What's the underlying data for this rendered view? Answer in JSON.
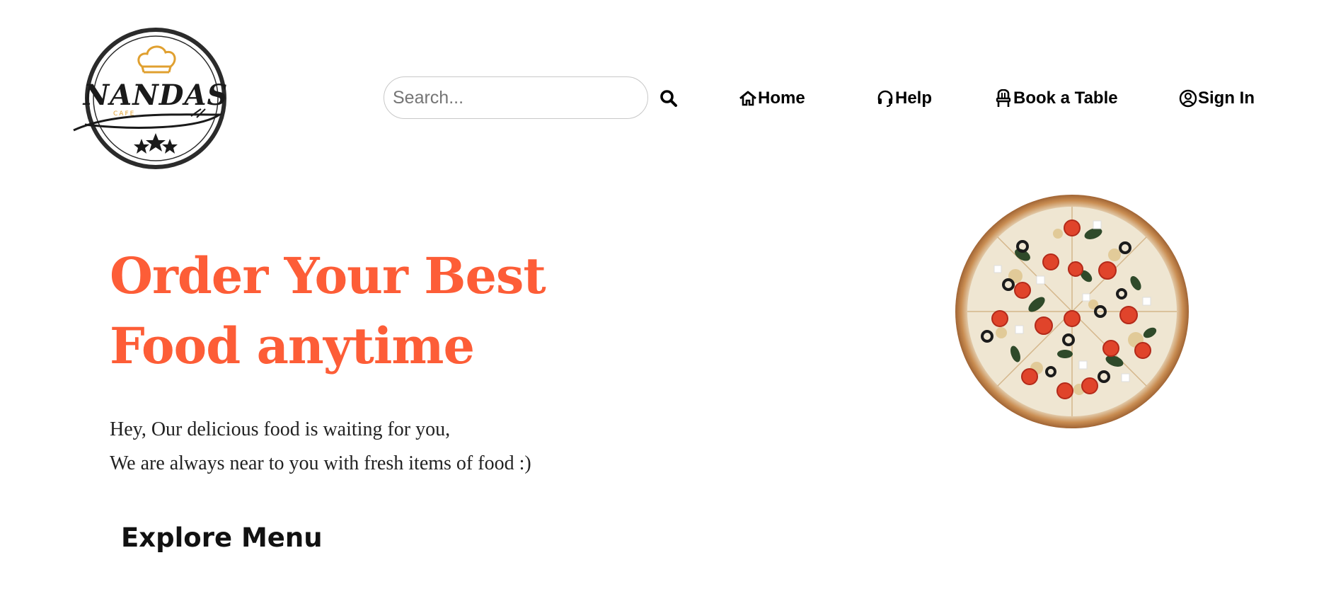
{
  "brand": {
    "logo_text": "NANDAS",
    "logo_subtext": "CAFE",
    "logo_icon": "chef-hat-icon"
  },
  "search": {
    "placeholder": "Search...",
    "value": "",
    "icon": "search-icon"
  },
  "nav": {
    "home": {
      "label": "Home",
      "icon": "home-icon"
    },
    "help": {
      "label": "Help",
      "icon": "headset-icon"
    },
    "book": {
      "label": "Book a Table",
      "icon": "chair-icon"
    },
    "signin": {
      "label": "Sign In",
      "icon": "user-circle-icon"
    }
  },
  "hero": {
    "title": "Order Your Best Food anytime",
    "line1": "Hey, Our delicious food is waiting for you,",
    "line2": "We are always near to you with fresh items of food :)",
    "image": "pizza-image"
  },
  "menu": {
    "heading": "Explore Menu"
  },
  "colors": {
    "accent": "#fd5d37",
    "logo_gold": "#e0a030",
    "text": "#222222"
  }
}
